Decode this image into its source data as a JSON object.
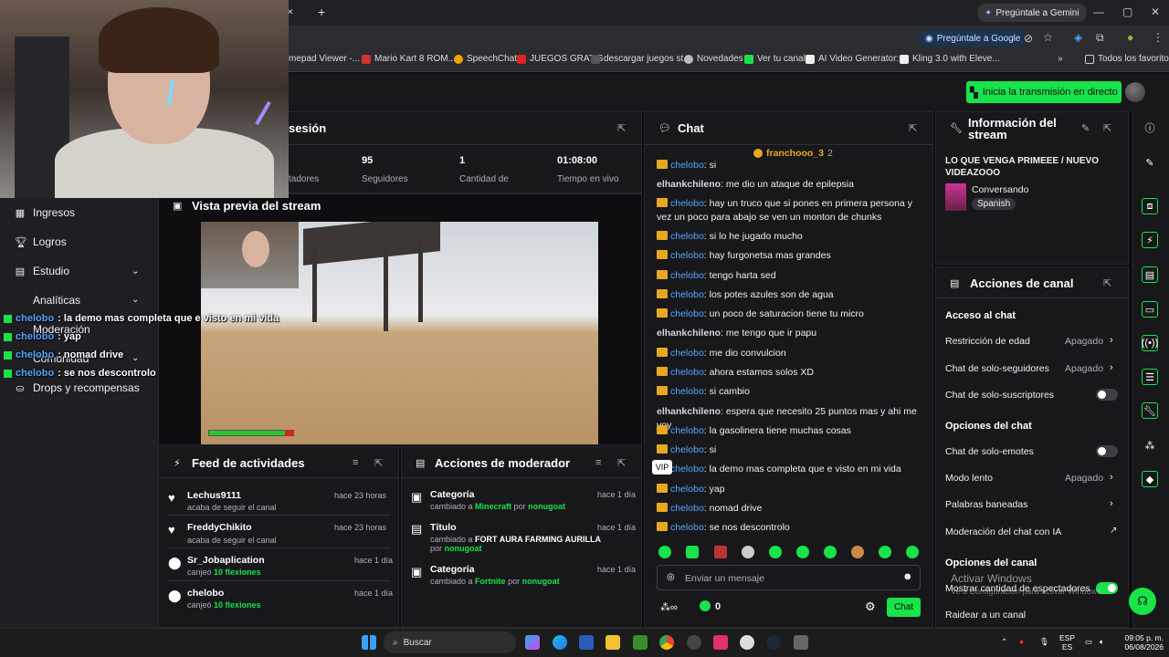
{
  "browser": {
    "gemini_label": "Pregúntale a Gemini",
    "ask_google_label": "Pregúntale a Google",
    "bookmarks": [
      "mepad Viewer -...",
      "Mario Kart 8 ROM...",
      "SpeechChat",
      "JUEGOS GRATIS",
      "descargar juegos st...",
      "Novedades",
      "Ver tu canal",
      "AI Video Generator:...",
      "Kling 3.0 with Eleve..."
    ],
    "all_favorites": "Todos los favoritos",
    "win_min": "—",
    "win_max": "▢",
    "win_close": "✕",
    "new_tab": "+",
    "tab_close": "✕"
  },
  "twitch": {
    "go_live_label": "Inicia la transmisión en directo",
    "session_title": "sesión",
    "stats": [
      {
        "value": "",
        "label": "tadores"
      },
      {
        "value": "95",
        "label": "Seguidores"
      },
      {
        "value": "1",
        "label": "Cantidad de"
      },
      {
        "value": "01:08:00",
        "label": "Tiempo en vivo"
      }
    ],
    "sidebar": [
      "Ingresos",
      "Logros",
      "Estudio",
      "Analíticas",
      "Moderación",
      "Comunidad",
      "Drops y recompensas"
    ],
    "preview_title": "Vista previa del stream",
    "feed_title": "Feed de actividades",
    "feed": [
      {
        "name": "Lechus9111",
        "sub": "acaba de seguir el canal",
        "highlight": "",
        "time": "hace 23 horas",
        "icon": "heart-icon"
      },
      {
        "name": "FreddyChikito",
        "sub": "acaba de seguir el canal",
        "highlight": "",
        "time": "hace 23 horas",
        "icon": "heart-icon"
      },
      {
        "name": "Sr_Jobaplication",
        "sub": "canjeó",
        "highlight": "10 flexiones",
        "time": "hace 1 día",
        "icon": "points-icon"
      },
      {
        "name": "chelobo",
        "sub": "canjeó",
        "highlight": "10 flexiones",
        "time": "hace 1 día",
        "icon": "points-icon"
      }
    ],
    "mod_title": "Acciones de moderador",
    "mod_actions": [
      {
        "title": "Categoría",
        "pre": "cambiado a",
        "value": "Minecraft",
        "by": "por",
        "user": "nonugoat",
        "time": "hace 1 día"
      },
      {
        "title": "Título",
        "pre": "cambiado a",
        "value": "FORT AURA FARMING AURILLA",
        "by": "por",
        "user": "nonugoat",
        "time": "hace 1 día"
      },
      {
        "title": "Categoría",
        "pre": "cambiado a",
        "value": "Fortnite",
        "by": "por",
        "user": "nonugoat",
        "time": "hace 1 día"
      }
    ],
    "chat_title": "Chat",
    "chat_top_user": "franchooo_3",
    "chat_top_count": "2",
    "chat": [
      {
        "badge": true,
        "user": "chelobo",
        "text": ": si"
      },
      {
        "badge": false,
        "user": "elhankchileno",
        "text": ": me dio un ataque de epilepsia"
      },
      {
        "badge": true,
        "user": "chelobo",
        "text": ": hay un truco que si pones en primera persona y vez un poco para abajo se ven un monton de chunks"
      },
      {
        "badge": true,
        "user": "chelobo",
        "text": ": si lo he jugado mucho"
      },
      {
        "badge": true,
        "user": "chelobo",
        "text": ": hay furgonetsa mas grandes"
      },
      {
        "badge": true,
        "user": "chelobo",
        "text": ": tengo harta sed"
      },
      {
        "badge": true,
        "user": "chelobo",
        "text": ": los potes azules son de agua"
      },
      {
        "badge": true,
        "user": "chelobo",
        "text": ": un poco de saturacion tiene tu micro"
      },
      {
        "badge": false,
        "user": "elhankchileno",
        "text": ": me tengo que ir papu"
      },
      {
        "badge": true,
        "user": "chelobo",
        "text": ": me dio convulcion"
      },
      {
        "badge": true,
        "user": "chelobo",
        "text": ": ahora estamos solos XD"
      },
      {
        "badge": true,
        "user": "chelobo",
        "text": ": si cambio"
      },
      {
        "badge": false,
        "user": "elhankchileno",
        "text": ": espera que necesito 25 puntos mas y ahi me voy"
      },
      {
        "badge": true,
        "user": "chelobo",
        "text": ": la gasolinera tiene muchas cosas"
      },
      {
        "badge": true,
        "user": "chelobo",
        "text": ": si"
      },
      {
        "badge": true,
        "user": "chelobo",
        "text": ": la demo mas completa que e visto en mi vida"
      },
      {
        "badge": true,
        "user": "chelobo",
        "text": ": yap"
      },
      {
        "badge": true,
        "user": "chelobo",
        "text": ": nomad drive"
      },
      {
        "badge": true,
        "user": "chelobo",
        "text": ": se nos descontrolo"
      }
    ],
    "vip_tooltip": "VIP",
    "chat_placeholder": "Enviar un mensaje",
    "points_value": "0",
    "chat_button": "Chat",
    "info_title": "Información del stream",
    "stream_title": "LO QUE VENGA PRIMEEE / NUEVO VIDEAZOOO",
    "category": "Conversando",
    "language": "Spanish",
    "channel_actions_title": "Acciones de canal",
    "chat_access_title": "Acceso al chat",
    "chat_options_title": "Opciones del chat",
    "channel_options_title": "Opciones del canal",
    "age_restriction": {
      "label": "Restricción de edad",
      "value": "Apagado"
    },
    "followers_only": {
      "label": "Chat de solo-seguidores",
      "value": "Apagado"
    },
    "subs_only": {
      "label": "Chat de solo-suscriptores"
    },
    "emotes_only": {
      "label": "Chat de solo-emotes"
    },
    "slow_mode": {
      "label": "Modo lento",
      "value": "Apagado"
    },
    "banned_words": {
      "label": "Palabras baneadas"
    },
    "ai_moderation": {
      "label": "Moderación del chat con IA"
    },
    "show_viewers": {
      "label": "Mostrar cantidad de espectadores",
      "on": true
    },
    "raid": {
      "label": "Raidear a un canal"
    }
  },
  "overlay_chat": [
    {
      "user": "chelobo",
      "text": ": la demo mas completa que e visto en mi vida"
    },
    {
      "user": "chelobo",
      "text": ": yap"
    },
    {
      "user": "chelobo",
      "text": ": nomad drive"
    },
    {
      "user": "chelobo",
      "text": ": se nos descontrolo"
    }
  ],
  "windows": {
    "search_label": "Buscar",
    "watermark_title": "Activar Windows",
    "watermark_sub": "Ve a Configuración para activar Windows.",
    "lang_top": "ESP",
    "lang_bottom": "ES",
    "time": "09:05 p. m.",
    "date": "06/08/2026"
  },
  "colors": {
    "accent": "#19e34a",
    "chat_user": "#56a6ff",
    "badge": "#e6a823"
  }
}
